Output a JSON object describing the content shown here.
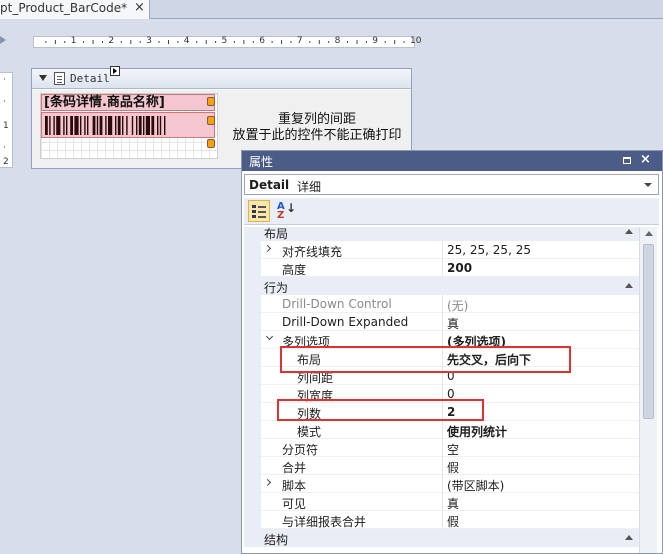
{
  "document_tab": {
    "title": "pt_Product_BarCode*",
    "close": "×"
  },
  "ruler": {
    "marks": [
      "1",
      "2",
      "3",
      "4",
      "5",
      "6",
      "7",
      "8",
      "9",
      "10"
    ]
  },
  "side_ruler": {
    "marks": [
      "1",
      "2"
    ]
  },
  "band": {
    "label": "Detail",
    "field_label": "[条码详情.商品名称]",
    "warning_line1": "重复列的间距",
    "warning_line2": "放置于此的控件不能正确打印"
  },
  "properties_panel": {
    "title": "属性",
    "object_name": "Detail",
    "object_type": "详细",
    "toolbar": {
      "categorized_active": true,
      "alphabetical_label": "AZ"
    },
    "rows": [
      {
        "kind": "category",
        "name": "布局"
      },
      {
        "kind": "prop",
        "name": "对齐线填充",
        "value": "25, 25, 25, 25",
        "expandable": true,
        "level": 0
      },
      {
        "kind": "prop",
        "name": "高度",
        "value": "200",
        "value_bold": true,
        "level": 0
      },
      {
        "kind": "category",
        "name": "行为"
      },
      {
        "kind": "prop",
        "name": "Drill-Down Control",
        "value": "(无)",
        "disabled": true,
        "level": 0
      },
      {
        "kind": "prop",
        "name": "Drill-Down Expanded",
        "value": "真",
        "level": 0
      },
      {
        "kind": "prop",
        "name": "多列选项",
        "value": "(多列选项)",
        "value_bold": true,
        "expanded": true,
        "level": 0
      },
      {
        "kind": "prop",
        "name": "布局",
        "value": "先交叉，后向下",
        "value_bold": true,
        "level": 1
      },
      {
        "kind": "prop",
        "name": "列间距",
        "value": "0",
        "level": 1
      },
      {
        "kind": "prop",
        "name": "列宽度",
        "value": "0",
        "level": 1
      },
      {
        "kind": "prop",
        "name": "列数",
        "value": "2",
        "value_bold": true,
        "level": 1
      },
      {
        "kind": "prop",
        "name": "模式",
        "value": "使用列统计",
        "value_bold": true,
        "level": 1
      },
      {
        "kind": "prop",
        "name": "分页符",
        "value": "空",
        "level": 0
      },
      {
        "kind": "prop",
        "name": "合并",
        "value": "假",
        "level": 0
      },
      {
        "kind": "prop",
        "name": "脚本",
        "value": "(带区脚本)",
        "expandable": true,
        "level": 0
      },
      {
        "kind": "prop",
        "name": "可见",
        "value": "真",
        "level": 0
      },
      {
        "kind": "prop",
        "name": "与详细报表合并",
        "value": "假",
        "level": 0
      },
      {
        "kind": "category",
        "name": "结构"
      }
    ]
  },
  "colors": {
    "panel_title_bg": "#4b5d86",
    "highlight": "#e03232",
    "field_bg": "#f4c6cf",
    "handle": "#f4a300"
  }
}
